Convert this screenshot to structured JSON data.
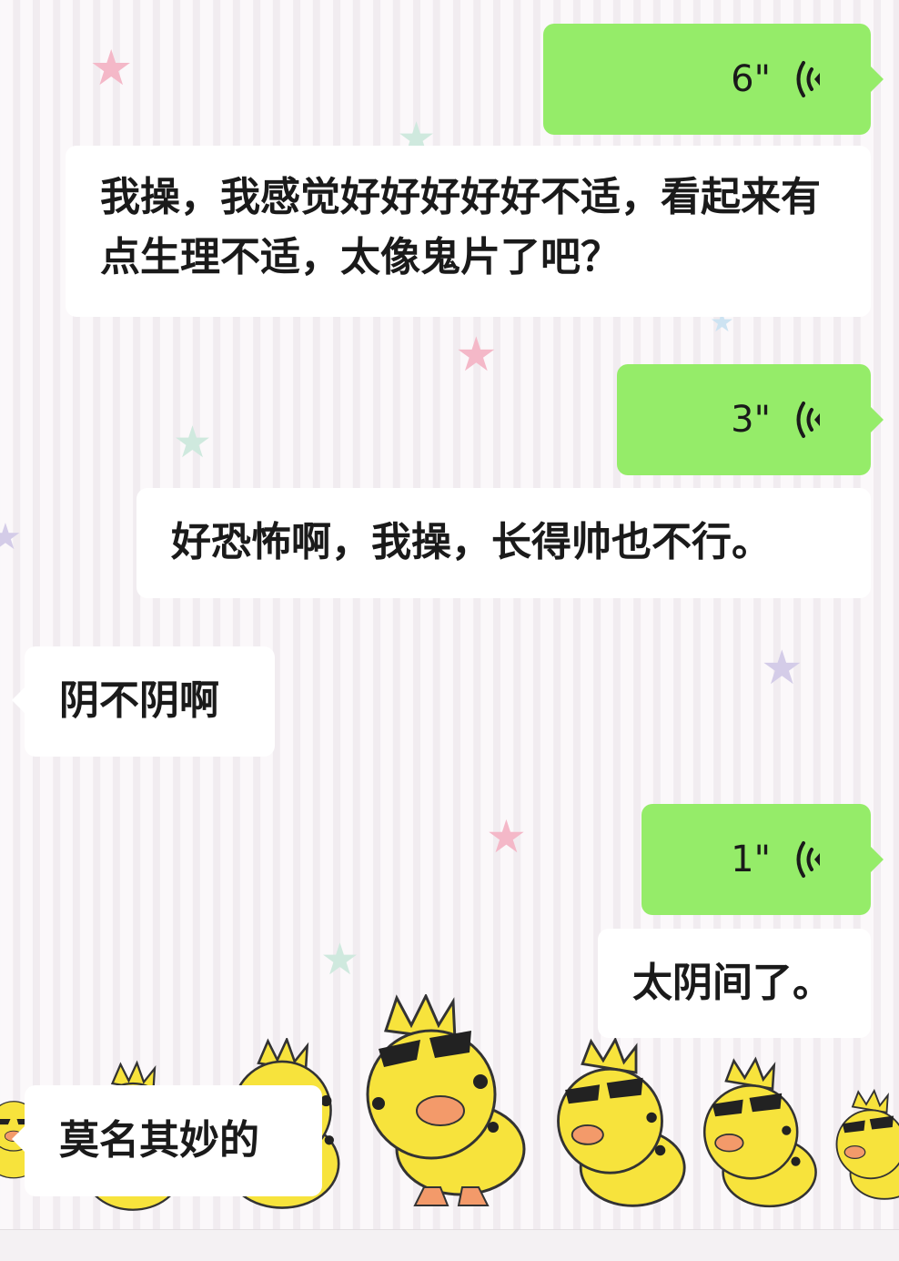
{
  "messages": [
    {
      "side": "sent",
      "type": "voice",
      "duration": "6\""
    },
    {
      "side": "sent",
      "type": "text",
      "text": "我操，我感觉好好好好好不适，看起来有点生理不适，太像鬼片了吧？"
    },
    {
      "side": "sent",
      "type": "voice",
      "duration": "3\""
    },
    {
      "side": "sent",
      "type": "text",
      "text": "好恐怖啊，我操，长得帅也不行。"
    },
    {
      "side": "received",
      "type": "text",
      "text": "阴不阴啊"
    },
    {
      "side": "sent",
      "type": "voice",
      "duration": "1\""
    },
    {
      "side": "sent",
      "type": "text",
      "text": "太阴间了。"
    },
    {
      "side": "received",
      "type": "text",
      "text": "莫名其妙的"
    }
  ],
  "icons": {
    "voice": "voice-wave-icon",
    "decoration": "yellow-duck-sunglasses",
    "stars": "star-icon"
  },
  "colors": {
    "voice_bubble": "#95ec69",
    "text_bubble": "#ffffff",
    "background": "#fbf8fa",
    "duck_body": "#f7e33c",
    "duck_beak": "#f39a6a",
    "star_pink": "#f4b8c8",
    "star_mint": "#cfe9de",
    "star_lilac": "#d4cce8",
    "star_blue": "#cde3f2"
  }
}
